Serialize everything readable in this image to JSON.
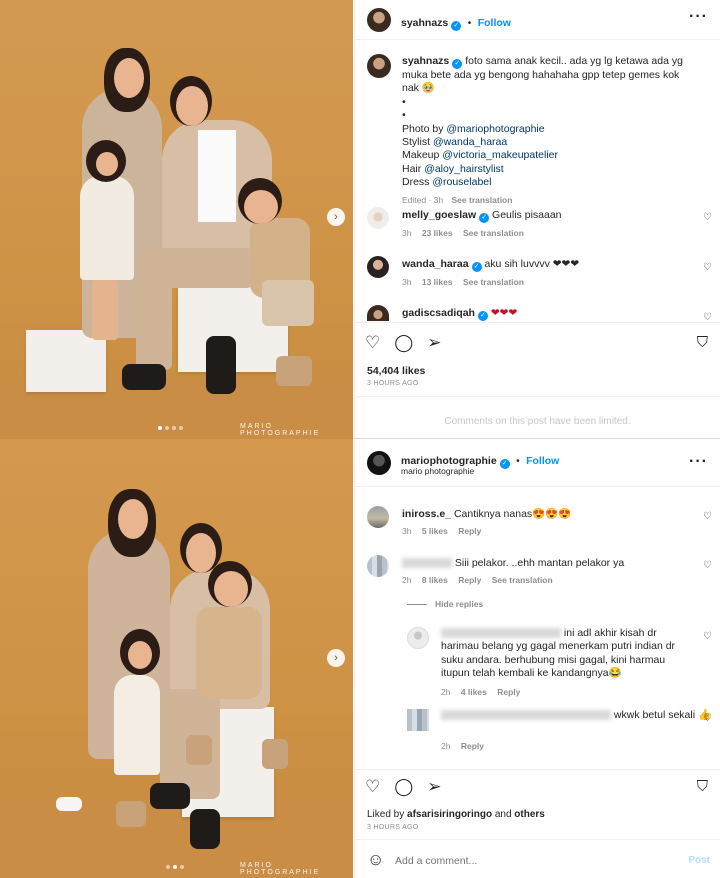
{
  "post1": {
    "watermark": "MARIO PHOTOGRAPHIE",
    "header": {
      "username": "syahnazs",
      "follow": "Follow"
    },
    "caption": {
      "username": "syahnazs",
      "text": "foto sama anak kecil.. ada yg lg ketawa ada yg muka bete ada yg bengong hahahaha gpp tetep gemes kok nak 🥹",
      "bullets": [
        "•",
        "•"
      ],
      "credits": [
        {
          "label": "Photo by",
          "handle": "@mariophotographie"
        },
        {
          "label": "Stylist",
          "handle": "@wanda_haraa"
        },
        {
          "label": "Makeup",
          "handle": "@victoria_makeupatelier"
        },
        {
          "label": "Hair",
          "handle": "@aloy_hairstylist"
        },
        {
          "label": "Dress",
          "handle": "@rouselabel"
        }
      ],
      "edited": "Edited · 3h",
      "see_translation": "See translation"
    },
    "comments": [
      {
        "username": "melly_goeslaw",
        "verified": true,
        "text": "Geulis pisaaan",
        "time": "3h",
        "likes": "23 likes",
        "translation": "See translation"
      },
      {
        "username": "wanda_haraa",
        "verified": true,
        "text": "aku sih luvvvv ❤❤❤",
        "time": "3h",
        "likes": "13 likes",
        "translation": "See translation"
      },
      {
        "username": "gadiscsadiqah",
        "verified": true,
        "text": "❤❤❤"
      }
    ],
    "likes_count": "54,404 likes",
    "posted_ago": "3 HOURS AGO",
    "limited_notice": "Comments on this post have been limited."
  },
  "post2": {
    "watermark": "MARIO PHOTOGRAPHIE",
    "header": {
      "username": "mariophotographie",
      "follow": "Follow",
      "subtitle": "mario photographie"
    },
    "comments": [
      {
        "username": "iniross.e_",
        "text": "Cantiknya nanas😍😍😍",
        "time": "3h",
        "likes": "5 likes",
        "reply": "Reply"
      },
      {
        "username": "",
        "text": "Siii pelakor. ..ehh mantan pelakor ya",
        "time": "2h",
        "likes": "8 likes",
        "reply": "Reply",
        "translation": "See translation"
      }
    ],
    "hide_replies": "Hide replies",
    "replies": [
      {
        "text_a": "ini adl akhir kisah dr",
        "text_b": "harimau belang yg gagal menerkam putri indian dr suku andara. berhubung misi gagal, kini harmau itupun telah kembali ke kandangnya😂",
        "time": "2h",
        "likes": "4 likes",
        "reply": "Reply"
      },
      {
        "text": "wkwk betul sekali 👍",
        "time": "2h",
        "reply": "Reply"
      }
    ],
    "liked_by": {
      "prefix": "Liked by",
      "user": "afsarisiringoringo",
      "and": "and",
      "others": "others"
    },
    "posted_ago": "3 HOURS AGO",
    "add_comment_placeholder": "Add a comment...",
    "post_button": "Post"
  },
  "icons": {
    "like": "heart-icon",
    "comment": "comment-icon",
    "share": "share-icon",
    "save": "bookmark-icon",
    "emoji": "emoji-icon",
    "more": "more-icon",
    "next": "chevron-right-icon"
  },
  "colors": {
    "accent": "#0095f6",
    "backdrop": "#cf9346",
    "muted": "#8e8e8e"
  }
}
